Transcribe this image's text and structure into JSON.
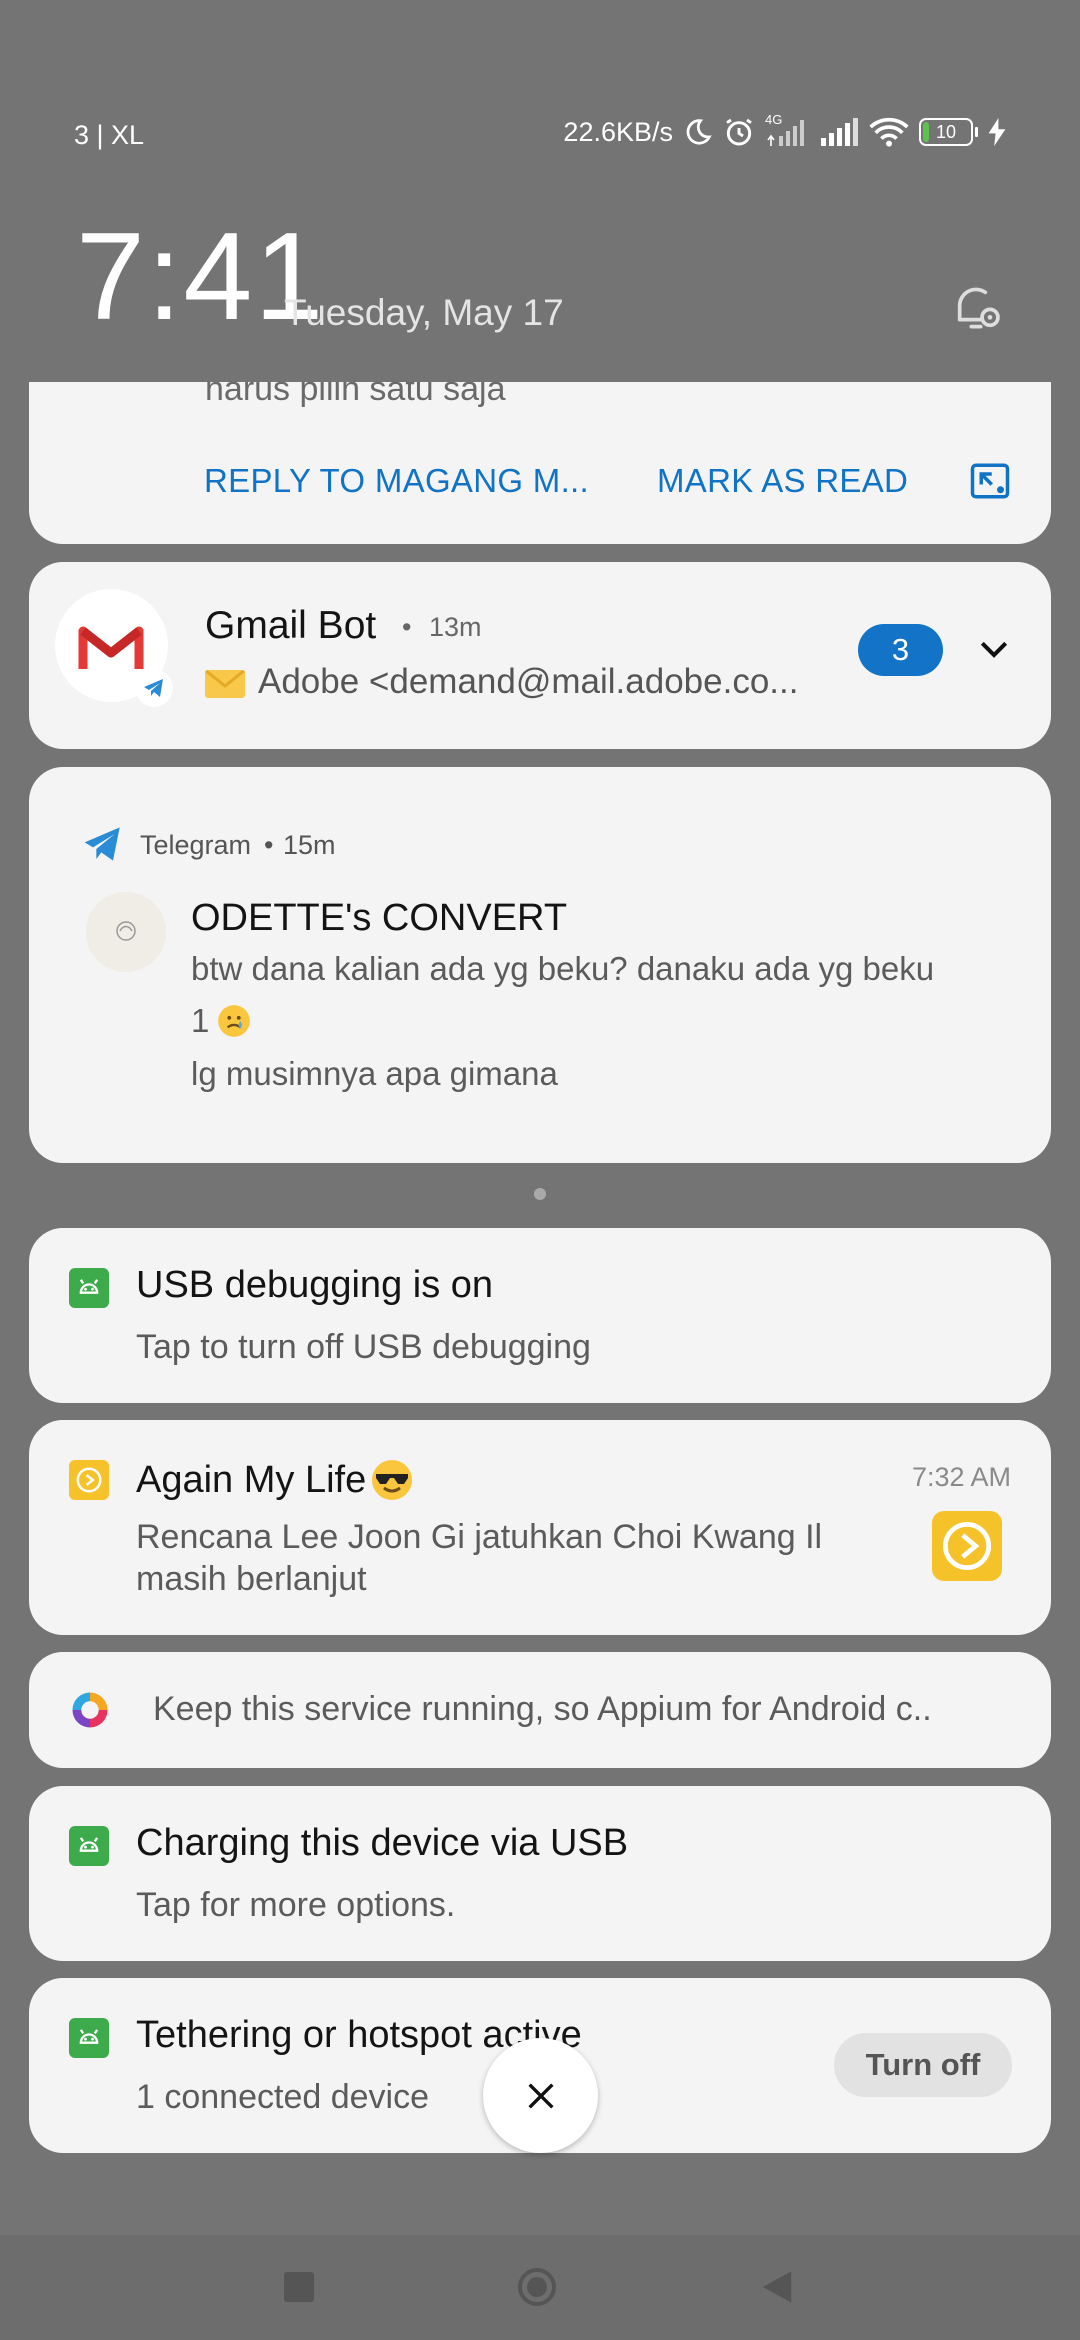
{
  "status_bar": {
    "carrier": "3 | XL",
    "net_speed": "22.6KB/s",
    "net_type": "4G",
    "battery": "10",
    "icons": [
      "moon-icon",
      "alarm-icon",
      "signal-4g-icon",
      "signal-icon",
      "wifi-icon",
      "battery-icon",
      "charging-icon"
    ]
  },
  "header": {
    "time": "7:41",
    "date": "Tuesday, May 17",
    "settings_icon": "notification-settings-icon"
  },
  "notifications": {
    "partial_email": {
      "text": "harus pilih satu saja",
      "reply_label": "REPLY TO MAGANG M...",
      "mark_read_label": "MARK AS READ"
    },
    "gmail": {
      "title": "Gmail Bot",
      "time": "13m",
      "preview": "Adobe <demand@mail.adobe.co...",
      "count": "3"
    },
    "telegram": {
      "app": "Telegram",
      "time": "15m",
      "sender": "ODETTE's CONVERT",
      "line1": "btw dana kalian ada yg beku? danaku ada yg beku",
      "line2": "1",
      "line3": "lg musimnya apa gimana"
    },
    "usb_debug": {
      "title": "USB debugging is on",
      "sub": "Tap to turn off USB debugging"
    },
    "again_my_life": {
      "title": "Again My Life",
      "time": "7:32 AM",
      "line1": "Rencana Lee Joon Gi jatuhkan Choi Kwang Il",
      "line2": "masih berlanjut"
    },
    "appium": {
      "text": "Keep this service running, so Appium for Android c.."
    },
    "charging": {
      "title": "Charging this device via USB",
      "sub": "Tap for more options."
    },
    "tethering": {
      "title": "Tethering or hotspot active",
      "sub": "1 connected device",
      "button": "Turn off"
    }
  },
  "colors": {
    "background": "#747474",
    "card": "#f4f4f4",
    "link": "#1073c6",
    "badge": "#1373c7",
    "android_green": "#3dab4b",
    "yellow_app": "#f6c22a"
  }
}
